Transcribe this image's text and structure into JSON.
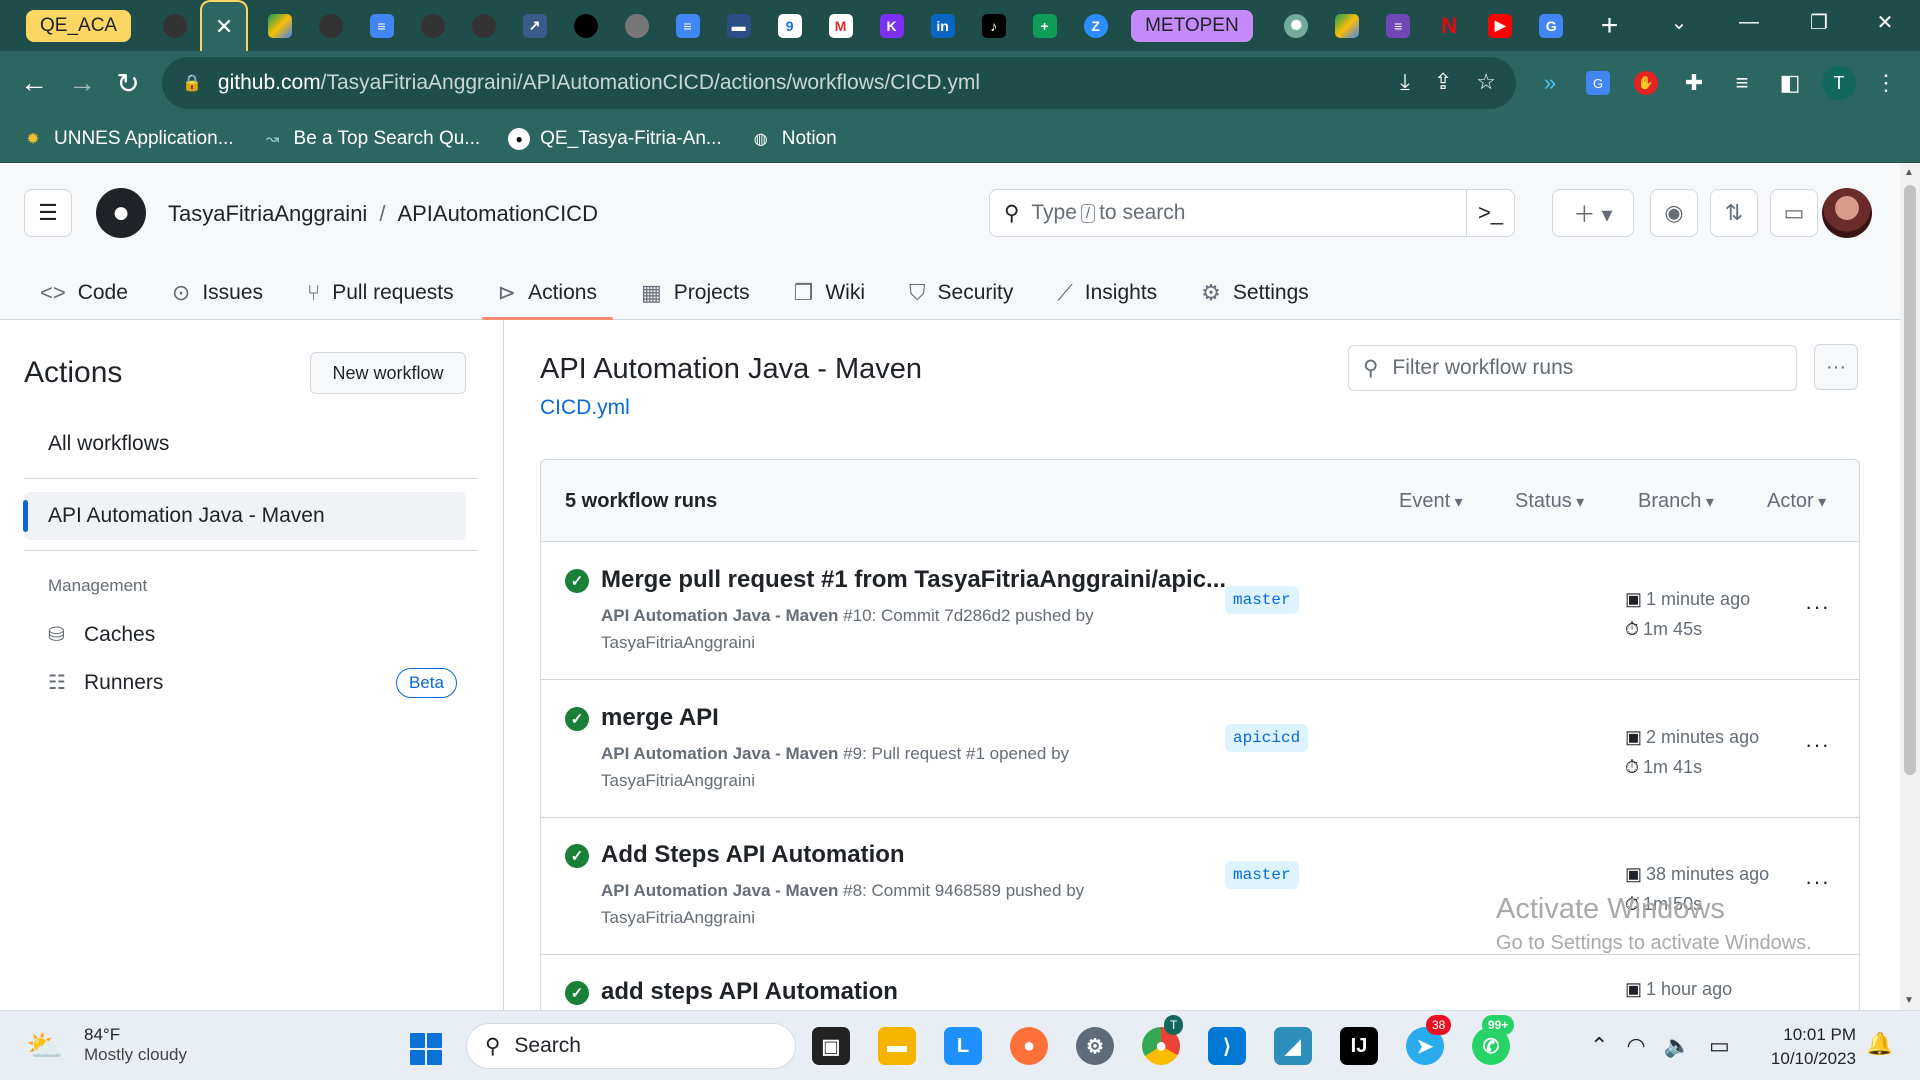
{
  "browser": {
    "tab_groups": [
      "QE_ACA",
      "METOPEN"
    ],
    "url_host": "github.com",
    "url_path": "/TasyaFitriaAnggraini/APIAutomationCICD/actions/workflows/CICD.yml",
    "profile_initial": "T",
    "bookmarks": [
      "UNNES Application...",
      "Be a Top Search Qu...",
      "QE_Tasya-Fitria-An...",
      "Notion"
    ]
  },
  "github": {
    "owner": "TasyaFitriaAnggraini",
    "separator": "/",
    "repo": "APIAutomationCICD",
    "search_prefix": "Type",
    "search_key": "/",
    "search_suffix": "to search",
    "tabs": [
      {
        "label": "Code",
        "icon": "code-icon"
      },
      {
        "label": "Issues",
        "icon": "issue-icon"
      },
      {
        "label": "Pull requests",
        "icon": "pull-request-icon"
      },
      {
        "label": "Actions",
        "icon": "play-icon"
      },
      {
        "label": "Projects",
        "icon": "table-icon"
      },
      {
        "label": "Wiki",
        "icon": "book-icon"
      },
      {
        "label": "Security",
        "icon": "shield-icon"
      },
      {
        "label": "Insights",
        "icon": "graph-icon"
      },
      {
        "label": "Settings",
        "icon": "gear-icon"
      }
    ]
  },
  "sidebar": {
    "title": "Actions",
    "new_workflow": "New workflow",
    "all_workflows": "All workflows",
    "selected_workflow": "API Automation Java - Maven",
    "management_heading": "Management",
    "caches": "Caches",
    "runners": "Runners",
    "beta": "Beta"
  },
  "main": {
    "title": "API Automation Java - Maven",
    "file": "CICD.yml",
    "filter_placeholder": "Filter workflow runs",
    "runs_count": "5 workflow runs",
    "filters": [
      "Event",
      "Status",
      "Branch",
      "Actor"
    ],
    "runs": [
      {
        "title": "Merge pull request #1 from TasyaFitriaAnggraini/apic...",
        "workflow": "API Automation Java - Maven",
        "detail": "#10: Commit 7d286d2 pushed by",
        "actor": "TasyaFitriaAnggraini",
        "branch": "master",
        "time": "1 minute ago",
        "duration": "1m 45s"
      },
      {
        "title": "merge API",
        "workflow": "API Automation Java - Maven",
        "detail": "#9: Pull request #1 opened by",
        "actor": "TasyaFitriaAnggraini",
        "branch": "apicicd",
        "time": "2 minutes ago",
        "duration": "1m 41s"
      },
      {
        "title": "Add Steps API Automation",
        "workflow": "API Automation Java - Maven",
        "detail": "#8: Commit 9468589 pushed by",
        "actor": "TasyaFitriaAnggraini",
        "branch": "master",
        "time": "38 minutes ago",
        "duration": "1m 50s"
      },
      {
        "title": "add steps API Automation",
        "workflow": "",
        "detail": "",
        "actor": "",
        "branch": "",
        "time": "1 hour ago",
        "duration": ""
      }
    ]
  },
  "watermark": {
    "line1": "Activate Windows",
    "line2": "Go to Settings to activate Windows."
  },
  "taskbar": {
    "temp": "84°F",
    "weather": "Mostly cloudy",
    "search": "Search",
    "time": "10:01 PM",
    "date": "10/10/2023",
    "badge_chrome": "T",
    "badge_telegram": "38",
    "badge_whatsapp": "99+"
  }
}
